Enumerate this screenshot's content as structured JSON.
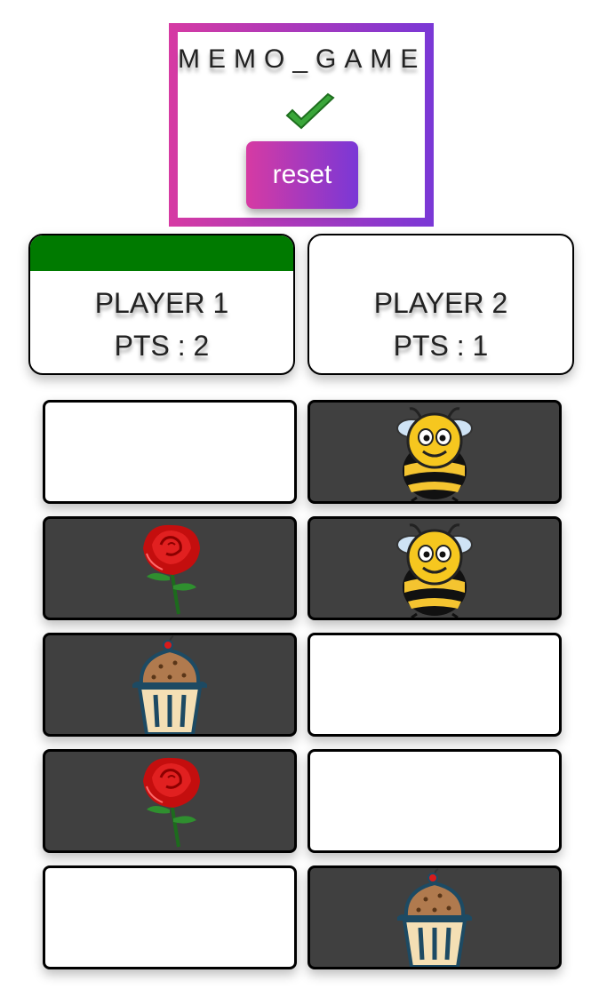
{
  "header": {
    "title": "MEMO_GAME",
    "status_icon": "check-icon",
    "reset_label": "reset"
  },
  "colors": {
    "gradient_start": "#d63aa3",
    "gradient_end": "#7a38d6",
    "active_turn": "#007a00",
    "revealed_card": "#404040"
  },
  "players": [
    {
      "name": "PLAYER 1",
      "points": "PTS : 2",
      "active": true
    },
    {
      "name": "PLAYER 2",
      "points": "PTS : 1",
      "active": false
    }
  ],
  "board": {
    "columns": 2,
    "cards": [
      {
        "state": "hidden",
        "image": ""
      },
      {
        "state": "shown",
        "image": "bee-icon"
      },
      {
        "state": "shown",
        "image": "rose-icon"
      },
      {
        "state": "shown",
        "image": "bee-icon"
      },
      {
        "state": "shown",
        "image": "cupcake-icon"
      },
      {
        "state": "hidden",
        "image": ""
      },
      {
        "state": "shown",
        "image": "rose-icon"
      },
      {
        "state": "hidden",
        "image": ""
      },
      {
        "state": "hidden",
        "image": ""
      },
      {
        "state": "shown",
        "image": "cupcake-icon"
      }
    ]
  }
}
